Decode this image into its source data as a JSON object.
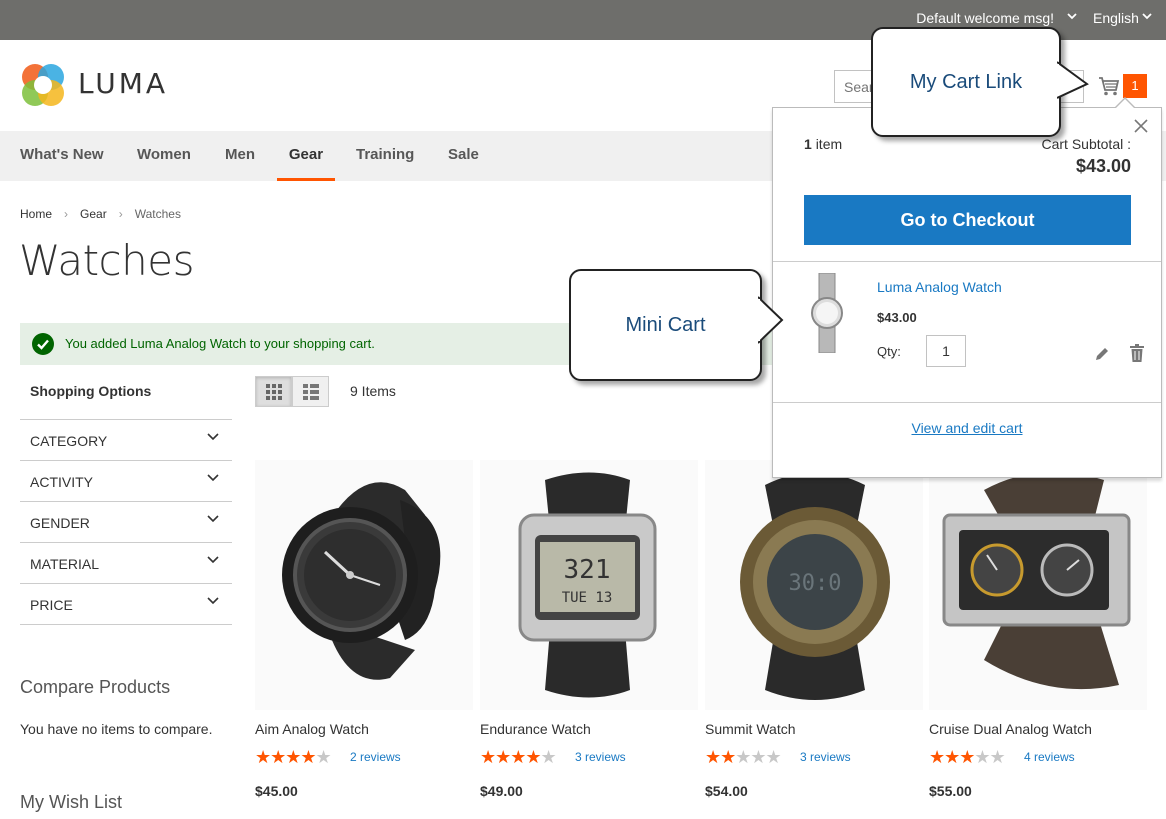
{
  "header": {
    "welcome": "Default welcome msg!",
    "language": "English",
    "brand": "LUMA",
    "search_placeholder": "Search entire store here...",
    "cart_count": "1"
  },
  "nav": {
    "items": [
      "What's New",
      "Women",
      "Men",
      "Gear",
      "Training",
      "Sale"
    ],
    "active": "Gear"
  },
  "breadcrumb": [
    "Home",
    "Gear",
    "Watches"
  ],
  "page_title": "Watches",
  "message": "You added Luma Analog Watch to your shopping cart.",
  "sidebar": {
    "title": "Shopping Options",
    "filters": [
      "CATEGORY",
      "ACTIVITY",
      "GENDER",
      "MATERIAL",
      "PRICE"
    ],
    "compare_title": "Compare Products",
    "compare_text": "You have no items to compare.",
    "wishlist_title": "My Wish List"
  },
  "toolbar": {
    "items_count": "9 Items",
    "view_modes": [
      "grid",
      "list"
    ],
    "active_mode": "grid"
  },
  "products": [
    {
      "name": "Aim Analog Watch",
      "rating": 4,
      "reviews": "2 reviews",
      "price": "$45.00"
    },
    {
      "name": "Endurance Watch",
      "rating": 4.5,
      "reviews": "3 reviews",
      "price": "$49.00"
    },
    {
      "name": "Summit Watch",
      "rating": 2.5,
      "reviews": "3 reviews",
      "price": "$54.00"
    },
    {
      "name": "Cruise Dual Analog Watch",
      "rating": 3,
      "reviews": "4 reviews",
      "price": "$55.00"
    }
  ],
  "minicart": {
    "count_num": "1",
    "count_word": "item",
    "subtotal_label": "Cart Subtotal :",
    "subtotal": "$43.00",
    "checkout_label": "Go to Checkout",
    "item": {
      "name": "Luma Analog Watch",
      "price": "$43.00",
      "qty_label": "Qty:",
      "qty": "1"
    },
    "view_cart": "View and edit cart"
  },
  "callouts": {
    "cart_link": "My Cart Link",
    "mini_cart": "Mini Cart"
  },
  "colors": {
    "accent": "#ff5501",
    "primary": "#1979c3",
    "topbar": "#6e6e6b",
    "success_bg": "#e5efe5",
    "success_text": "#006400"
  }
}
